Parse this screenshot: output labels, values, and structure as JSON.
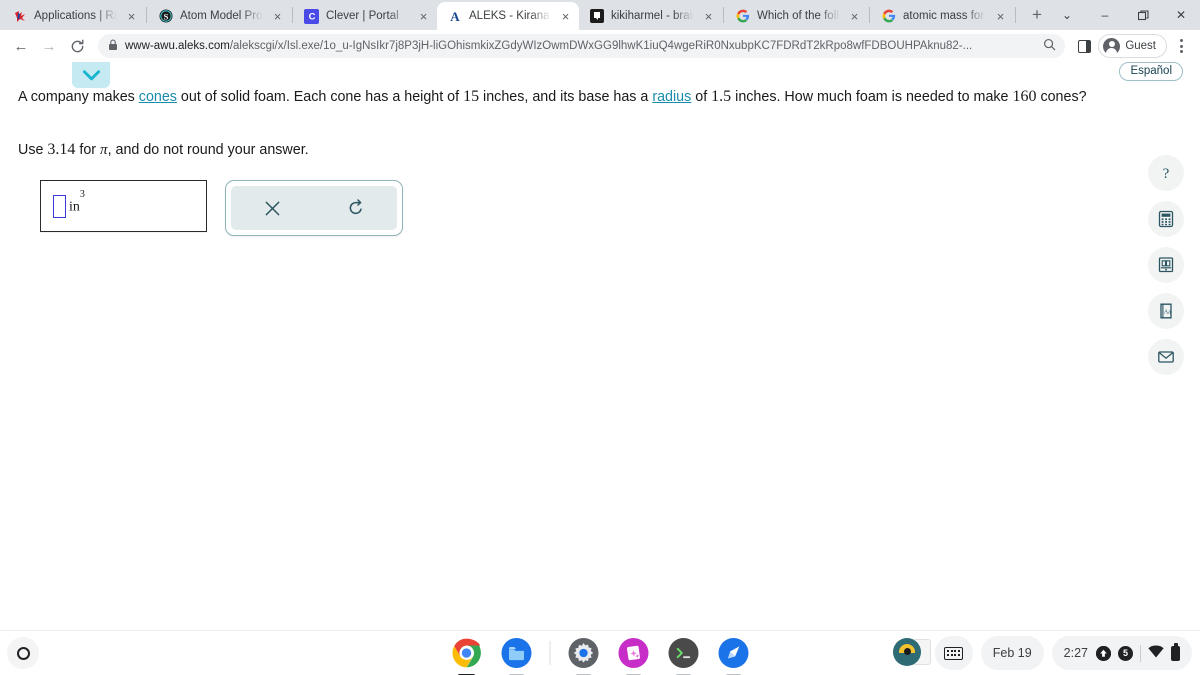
{
  "browser": {
    "tabs": [
      {
        "title": "Applications | Rap",
        "favicon": "rap-logo-icon",
        "active": false
      },
      {
        "title": "Atom Model Proje",
        "favicon": "sutori-icon",
        "active": false
      },
      {
        "title": "Clever | Portal",
        "favicon": "clever-icon",
        "active": false
      },
      {
        "title": "ALEKS - Kirana Ha",
        "favicon": "aleks-icon",
        "active": true
      },
      {
        "title": "kikiharmel - brainl",
        "favicon": "brainly-icon",
        "active": false
      },
      {
        "title": "Which of the follo",
        "favicon": "google-icon",
        "active": false
      },
      {
        "title": "atomic mass for n",
        "favicon": "google-icon",
        "active": false
      }
    ],
    "new_tab_label": "+",
    "tab_close_label": "×",
    "window_controls": {
      "list": "⌄",
      "minimize": "–",
      "maximize": "❐",
      "close": "✕"
    },
    "toolbar": {
      "back_label": "←",
      "forward_label": "→",
      "reload_label": "⟳",
      "url_host": "www-awu.aleks.com",
      "url_path": "/alekscgi/x/Isl.exe/1o_u-IgNsIkr7j8P3jH-liGOhismkixZGdyWIzOwmDWxGG9lhwK1iuQ4wgeRiR0NxubpKC7FDRdT2kRpo8wfFDBOUHPAknu82-...",
      "search_icon": "search-icon",
      "side_panel_icon": "side-panel-icon",
      "profile_label": "Guest",
      "menu_icon": "kebab-menu-icon"
    }
  },
  "page": {
    "collapse_chevron": "chevron-down-icon",
    "espanol_label": "Español",
    "problem": {
      "part1": "A company makes ",
      "link1": "cones",
      "part2": " out of solid foam. Each cone has a height of ",
      "height": "15",
      "part3": " inches, and its base has a ",
      "link2": "radius",
      "part4": " of ",
      "radius": "1.5",
      "part5": " inches. How much foam is needed to make ",
      "count": "160",
      "part6": " cones?"
    },
    "instruction": {
      "prefix": "Use ",
      "pi_value": "3.14",
      "middle": " for ",
      "pi_symbol": "π",
      "suffix": ", and do not round your answer."
    },
    "answer": {
      "value": "",
      "unit": "in",
      "exponent": "3"
    },
    "buttons": {
      "clear_label": "✕",
      "clear_name": "clear-button",
      "undo_label": "↺",
      "undo_name": "undo-button"
    },
    "tools": [
      {
        "name": "help-icon",
        "glyph": "?"
      },
      {
        "name": "calculator-icon",
        "glyph": "calc"
      },
      {
        "name": "reference-icon",
        "glyph": "ref"
      },
      {
        "name": "dictionary-icon",
        "glyph": "Aa"
      },
      {
        "name": "message-icon",
        "glyph": "mail"
      }
    ]
  },
  "shelf": {
    "launcher_name": "launcher-button",
    "apps": [
      {
        "name": "chrome-app-icon",
        "running": true
      },
      {
        "name": "files-app-icon",
        "running": false
      },
      {
        "name": "settings-app-icon",
        "running": false
      },
      {
        "name": "photos-app-icon",
        "running": false
      },
      {
        "name": "terminal-app-icon",
        "running": false
      },
      {
        "name": "explore-app-icon",
        "running": false
      }
    ],
    "status": {
      "date": "Feb 19",
      "time": "2:27",
      "notification_badge": "5",
      "keyboard_icon": "keyboard-icon",
      "wifi_icon": "wifi-icon",
      "battery_icon": "battery-icon"
    }
  },
  "colors": {
    "accent": "#1a8cab",
    "tab_bar": "#dee1e6",
    "chevron_bg": "#c5eaf2",
    "panel_bg": "#e3eaeb",
    "tool_teal": "#2b5560"
  }
}
